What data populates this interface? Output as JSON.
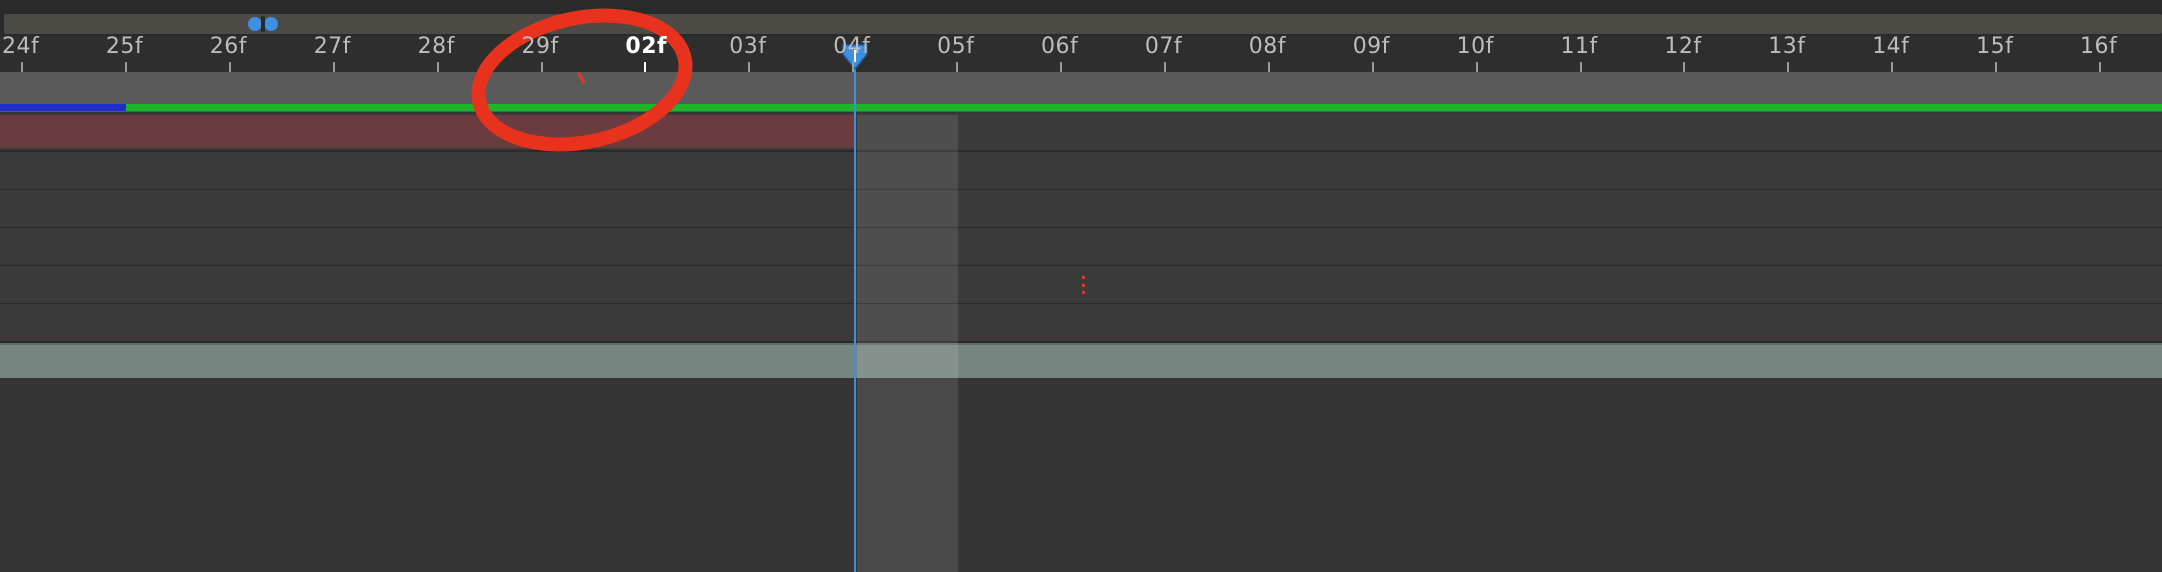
{
  "timeline": {
    "ruler": {
      "labels": [
        "24f",
        "25f",
        "26f",
        "27f",
        "28f",
        "29f",
        "02f",
        "03f",
        "04f",
        "05f",
        "06f",
        "07f",
        "08f",
        "09f",
        "10f",
        "11f",
        "12f",
        "13f",
        "14f",
        "15f",
        "16f"
      ],
      "current_label": "02f"
    },
    "playhead": {
      "label": "04f"
    },
    "tracks": [
      {
        "type": "layer-bar",
        "color": "#6b3c3f"
      },
      {
        "type": "empty"
      },
      {
        "type": "empty"
      },
      {
        "type": "empty"
      },
      {
        "type": "empty"
      },
      {
        "type": "empty"
      },
      {
        "type": "adjustment-bar",
        "color": "#778580"
      }
    ],
    "colors": {
      "playhead": "#3d8fe0",
      "ram_preview_green": "#1fb52a",
      "ram_preview_blue": "#1f2ec8",
      "annotation": "#e8321e"
    },
    "icons": [
      "navigator-handle-icon",
      "playhead-icon"
    ],
    "annotation": {
      "shape": "ellipse",
      "around": "02f"
    }
  }
}
